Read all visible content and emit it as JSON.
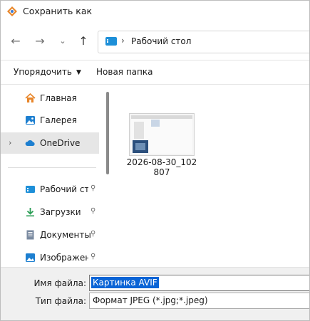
{
  "window": {
    "title": "Сохранить как"
  },
  "navigation": {
    "back_icon": "arrow-left",
    "forward_icon": "arrow-right",
    "recent_icon": "chevron-down",
    "up_icon": "arrow-up",
    "address": {
      "location": "Рабочий стол",
      "separator": "›"
    }
  },
  "commandbar": {
    "organize_label": "Упорядочить",
    "new_folder_label": "Новая папка"
  },
  "sidebar": {
    "items": [
      {
        "label": "Главная",
        "icon": "home-icon"
      },
      {
        "label": "Галерея",
        "icon": "gallery-icon"
      },
      {
        "label": "OneDrive",
        "icon": "cloud-icon",
        "expand": "›",
        "selected": true
      },
      {
        "label": "Рабочий стол",
        "icon": "desktop-icon",
        "pin": "📌"
      },
      {
        "label": "Загрузки",
        "icon": "download-icon",
        "pin": "📌"
      },
      {
        "label": "Документы",
        "icon": "document-icon",
        "pin": "📌"
      },
      {
        "label": "Изображения",
        "icon": "pictures-icon",
        "pin": "📌"
      }
    ]
  },
  "content": {
    "files": [
      {
        "name": "2026-08-30_102807"
      }
    ]
  },
  "form": {
    "filename_label": "Имя файла:",
    "filename_value": "Картинка AVIF",
    "filetype_label": "Тип файла:",
    "filetype_value": "Формат JPEG (*.jpg;*.jpeg)"
  },
  "colors": {
    "accent": "#0a64d6",
    "selected_row": "#e6e6e6",
    "folder_blue": "#1d8fd8",
    "home_orange": "#e8862a"
  }
}
